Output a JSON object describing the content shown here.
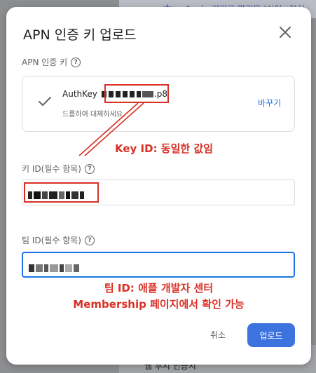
{
  "background": {
    "top_text": "Apple 기기로 알림을 보내는 혁신",
    "bottom_text": "웹 푸시 인증서"
  },
  "modal": {
    "title": "APN 인증 키 업로드",
    "apn_key": {
      "label": "APN 인증 키",
      "file_prefix": "AuthKey",
      "file_suffix": ".p8",
      "hint": "드롭하여 대체하세요",
      "replace_label": "바꾸기"
    },
    "key_id": {
      "label": "키 ID(필수 항목)"
    },
    "team_id": {
      "label": "팀 ID(필수 항목)"
    },
    "annotations": {
      "key_id_note": "Key ID: 동일한 값임",
      "team_id_line1": "팀 ID: 애플 개발자 센터",
      "team_id_line2": "Membership 페이지에서 확인 가능"
    },
    "buttons": {
      "cancel": "취소",
      "upload": "업로드"
    }
  },
  "colors": {
    "annotation_red": "#d93025",
    "accent_blue": "#1a73e8",
    "upload_button": "#3d73de"
  },
  "icons": {
    "close": "close-icon",
    "help": "help-icon",
    "check": "check-icon",
    "star": "star-icon"
  }
}
